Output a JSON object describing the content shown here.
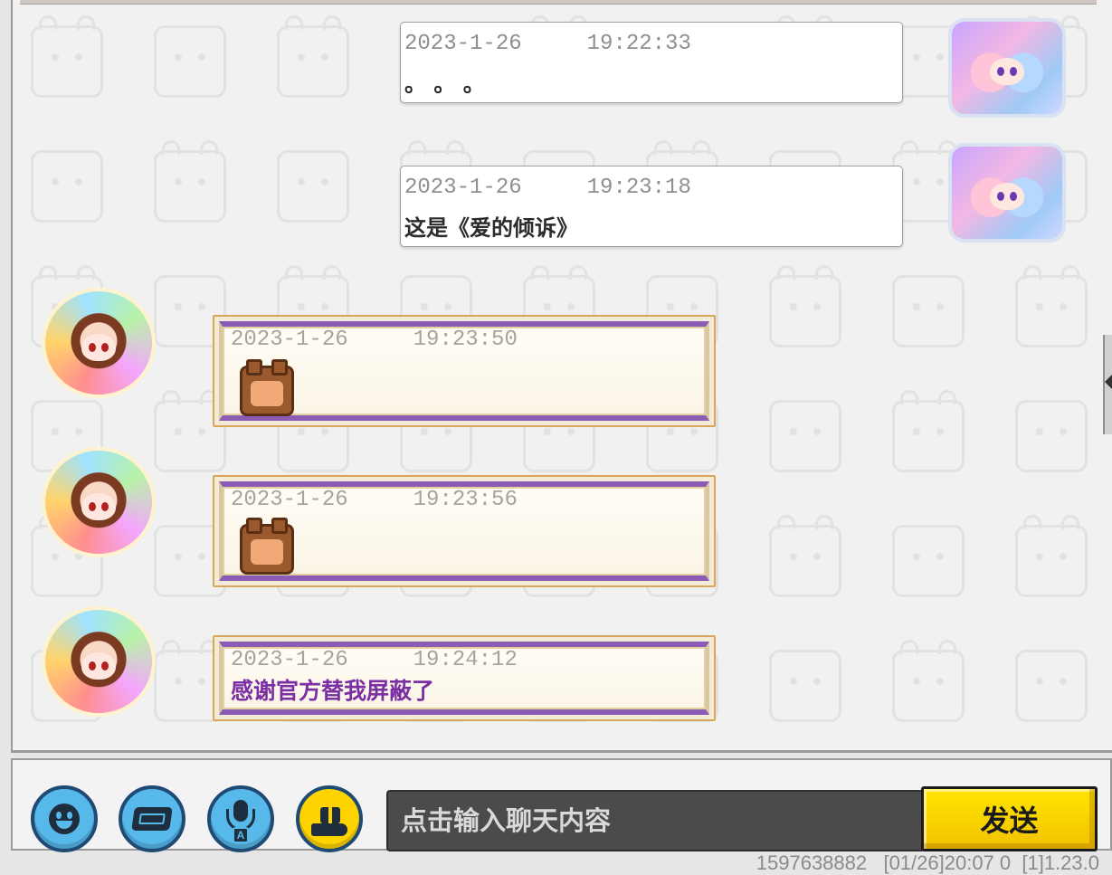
{
  "messages": [
    {
      "side": "self",
      "time": "2023-1-26     19:22:33",
      "text": "。 。 。",
      "avatar": "anime-girl-avatar"
    },
    {
      "side": "self",
      "time": "2023-1-26     19:23:18",
      "text": "这是《爱的倾诉》",
      "avatar": "anime-girl-avatar"
    },
    {
      "side": "other",
      "time": "2023-1-26     19:23:50",
      "sticker": "cow-thumbs-up-sticker",
      "avatar": "red-hair-girl-avatar"
    },
    {
      "side": "other",
      "time": "2023-1-26     19:23:56",
      "sticker": "cow-blushing-sticker",
      "avatar": "red-hair-girl-avatar"
    },
    {
      "side": "other",
      "time": "2023-1-26     19:24:12",
      "text": "感谢官方替我屏蔽了",
      "avatar": "red-hair-girl-avatar"
    }
  ],
  "toolbar": {
    "emoji_icon": "smiley-face-icon",
    "card_icon": "card-icon",
    "voice_icon": "microphone-icon",
    "voice_badge": "A",
    "gift_icon": "gift-hand-icon"
  },
  "input": {
    "placeholder": "点击输入聊天内容",
    "value": ""
  },
  "send": {
    "label": "发送"
  },
  "status": {
    "text": "1597638882   [01/26]20:07 0  [1]1.23.0"
  },
  "colors": {
    "accent_yellow": "#ffd300",
    "button_blue": "#57b8ea",
    "other_text_purple": "#7b2fa3",
    "bubble_border_gold": "#d8a85a"
  }
}
